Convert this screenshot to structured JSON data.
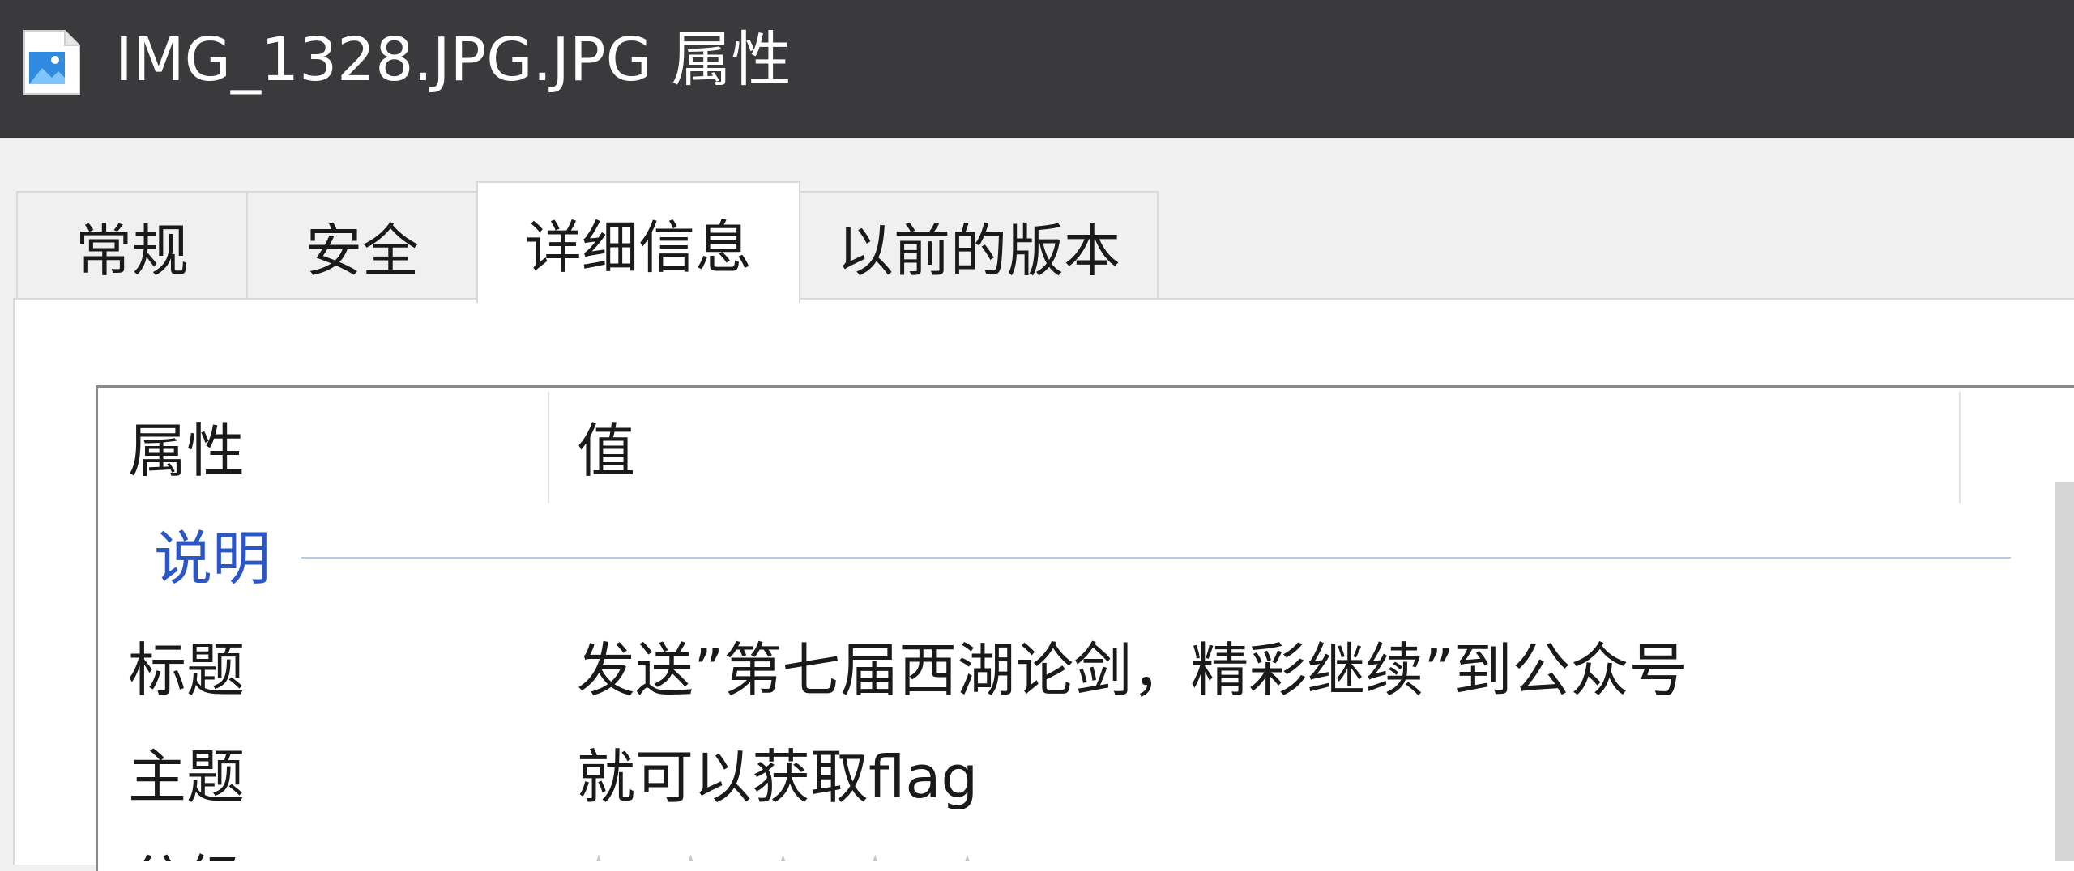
{
  "window": {
    "title": "IMG_1328.JPG.JPG 属性",
    "icon": "image-file-icon"
  },
  "tabs": [
    {
      "label": "常规",
      "active": false
    },
    {
      "label": "安全",
      "active": false
    },
    {
      "label": "详细信息",
      "active": true
    },
    {
      "label": "以前的版本",
      "active": false
    }
  ],
  "details": {
    "columns": {
      "property": "属性",
      "value": "值"
    },
    "group": "说明",
    "rows": [
      {
        "property": "标题",
        "value": "发送”第七届西湖论剑，精彩继续”到公众号"
      },
      {
        "property": "主题",
        "value": "就可以获取flag"
      },
      {
        "property": "分级",
        "value": "★★★★★"
      }
    ]
  },
  "colors": {
    "titlebar": "#3a3a3d",
    "group_label": "#2b56c8",
    "group_line": "#b8c9e6"
  }
}
